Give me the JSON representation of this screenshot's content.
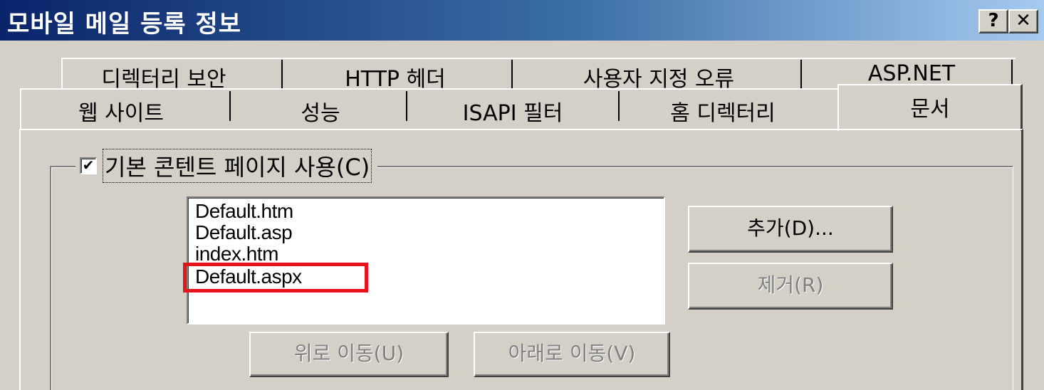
{
  "window": {
    "title": "모바일 메일 등록 정보",
    "help_label": "?",
    "close_label": "✕"
  },
  "tabs": {
    "row1": [
      "디렉터리 보안",
      "HTTP 헤더",
      "사용자 지정 오류",
      "ASP.NET"
    ],
    "row2": [
      "웹 사이트",
      "성능",
      "ISAPI 필터",
      "홈 디렉터리",
      "문서"
    ],
    "active": "문서"
  },
  "default_content": {
    "checkbox_label": "기본 콘텐트 페이지 사용(C)",
    "checked": true,
    "check_mark": "✔",
    "documents": [
      "Default.htm",
      "Default.asp",
      "index.htm",
      "Default.aspx"
    ],
    "highlighted": "Default.aspx"
  },
  "buttons": {
    "add": "추가(D)...",
    "remove": "제거(R)",
    "move_up": "위로 이동(U)",
    "move_down": "아래로 이동(V)"
  },
  "colors": {
    "highlight": "#e8121a",
    "titlebar_start": "#0a246a",
    "titlebar_end": "#a6caf0",
    "dialog_bg": "#d4d0c8"
  }
}
